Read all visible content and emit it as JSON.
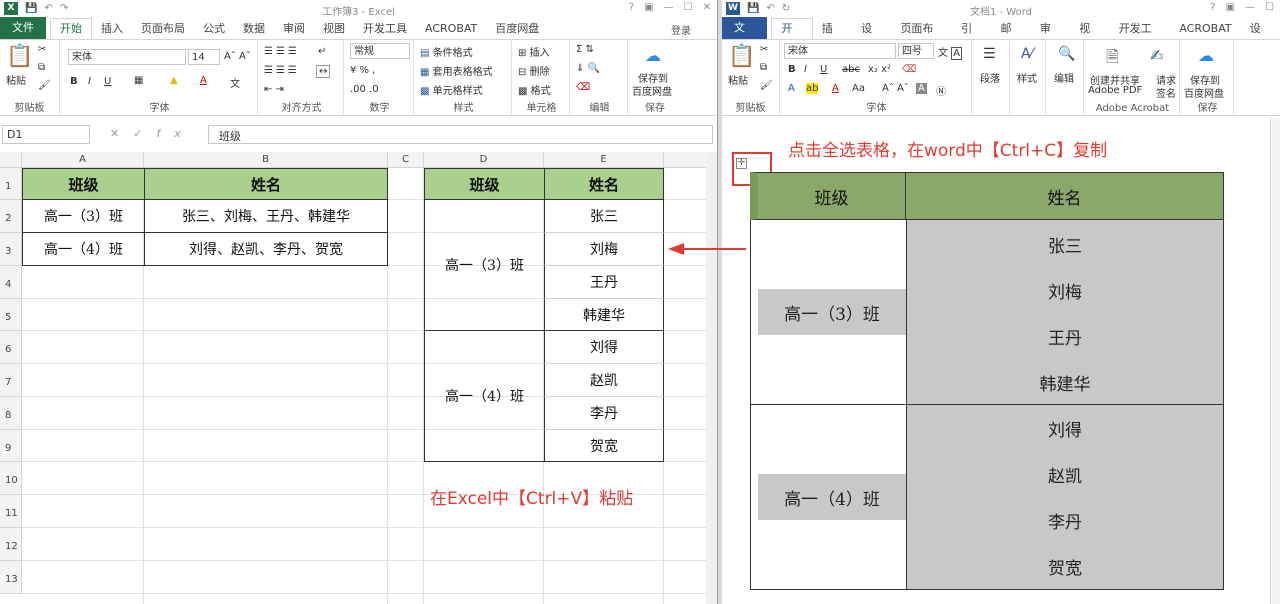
{
  "excel": {
    "title": "工作簿3 - Excel",
    "help": "?",
    "tabs": [
      "文件",
      "开始",
      "插入",
      "页面布局",
      "公式",
      "数据",
      "审阅",
      "视图",
      "开发工具",
      "ACROBAT",
      "百度网盘"
    ],
    "login": "登录",
    "ribbon": {
      "paste": "粘贴",
      "clipboard": "剪贴板",
      "font_name": "宋体",
      "font_size": "14",
      "font": "字体",
      "alignment": "对齐方式",
      "number_format": "常规",
      "number": "数字",
      "cond_format": "条件格式",
      "table_format": "套用表格格式",
      "cell_style": "单元格样式",
      "styles": "样式",
      "insert": "插入",
      "delete": "删除",
      "format": "格式",
      "cells": "单元格",
      "editing": "编辑",
      "save_to": "保存到",
      "baidu_disk": "百度网盘",
      "save": "保存"
    },
    "name_box": "D1",
    "formula_content": "班级",
    "columns": [
      "A",
      "B",
      "C",
      "D",
      "E"
    ],
    "rows": [
      "1",
      "2",
      "3",
      "4",
      "5",
      "6",
      "7",
      "8",
      "9",
      "10",
      "11",
      "12",
      "13"
    ],
    "table1": {
      "header": [
        "班级",
        "姓名"
      ],
      "rows": [
        [
          "高一（3）班",
          "张三、刘梅、王丹、韩建华"
        ],
        [
          "高一（4）班",
          "刘得、赵凯、李丹、贺宽"
        ]
      ]
    },
    "table2": {
      "header": [
        "班级",
        "姓名"
      ],
      "groups": [
        {
          "class": "高一（3）班",
          "names": [
            "张三",
            "刘梅",
            "王丹",
            "韩建华"
          ]
        },
        {
          "class": "高一（4）班",
          "names": [
            "刘得",
            "赵凯",
            "李丹",
            "贺宽"
          ]
        }
      ]
    },
    "paste_note": "在Excel中【Ctrl+V】粘贴"
  },
  "word": {
    "title": "文档1 - Word",
    "help": "?",
    "tabs": [
      "文件",
      "开始",
      "插入",
      "设计",
      "页面布局",
      "引用",
      "邮件",
      "审阅",
      "视图",
      "开发工具",
      "ACROBAT",
      "设计"
    ],
    "ribbon": {
      "paste": "粘贴",
      "clipboard": "剪贴板",
      "font_name": "宋体",
      "font_size": "四号",
      "font": "字体",
      "paragraph": "段落",
      "styles": "样式",
      "editing": "编辑",
      "create_share": "创建并共享",
      "adobe_pdf": "Adobe PDF",
      "request": "请求",
      "sign": "签名",
      "adobe_acrobat": "Adobe Acrobat",
      "save_to": "保存到",
      "baidu_disk": "百度网盘",
      "save": "保存"
    },
    "copy_note": "点击全选表格，在word中【Ctrl+C】复制",
    "table": {
      "header": [
        "班级",
        "姓名"
      ],
      "groups": [
        {
          "class": "高一（3）班",
          "names": [
            "张三",
            "刘梅",
            "王丹",
            "韩建华"
          ]
        },
        {
          "class": "高一（4）班",
          "names": [
            "刘得",
            "赵凯",
            "李丹",
            "贺宽"
          ]
        }
      ]
    }
  }
}
